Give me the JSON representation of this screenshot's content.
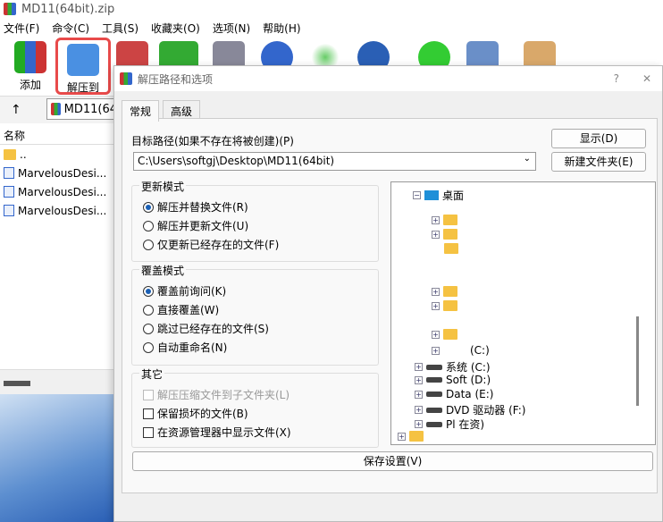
{
  "window": {
    "title": "MD11(64bit).zip"
  },
  "menu": [
    "文件(F)",
    "命令(C)",
    "工具(S)",
    "收藏夹(O)",
    "选项(N)",
    "帮助(H)"
  ],
  "toolbar": {
    "add": "添加",
    "extract_to": "解压到"
  },
  "address": {
    "path": "MD11(64"
  },
  "list": {
    "header": "名称",
    "items": [
      "..",
      "MarvelousDesi...",
      "MarvelousDesi...",
      "MarvelousDesi..."
    ]
  },
  "dialog": {
    "title": "解压路径和选项",
    "help": "?",
    "close": "✕",
    "tabs": [
      "常规",
      "高级"
    ],
    "path_label": "目标路径(如果不存在将被创建)(P)",
    "path_value": "C:\\Users\\softgj\\Desktop\\MD11(64bit)",
    "show_button": "显示(D)",
    "new_folder_button": "新建文件夹(E)",
    "update_mode": {
      "label": "更新模式",
      "options": [
        "解压并替换文件(R)",
        "解压并更新文件(U)",
        "仅更新已经存在的文件(F)"
      ],
      "selected": 0
    },
    "overwrite_mode": {
      "label": "覆盖模式",
      "options": [
        "覆盖前询问(K)",
        "直接覆盖(W)",
        "跳过已经存在的文件(S)",
        "自动重命名(N)"
      ],
      "selected": 0
    },
    "misc": {
      "label": "其它",
      "options": [
        {
          "label": "解压压缩文件到子文件夹(L)",
          "checked": false,
          "disabled": true
        },
        {
          "label": "保留损坏的文件(B)",
          "checked": false
        },
        {
          "label": "在资源管理器中显示文件(X)",
          "checked": false
        }
      ]
    },
    "tree": {
      "desktop": "桌面",
      "partial": "(C:)",
      "drives": [
        "系统 (C:)",
        "Soft (D:)",
        "Data (E:)",
        "DVD 驱动器 (F:)",
        "Pl 在资)"
      ]
    },
    "save_button": "保存设置(V)"
  },
  "colors": {
    "highlight": "#e84a4a",
    "accent": "#1a5fb4"
  }
}
